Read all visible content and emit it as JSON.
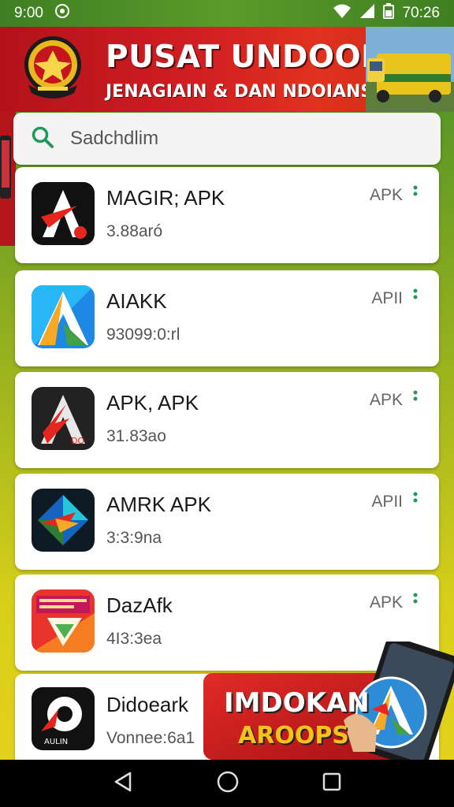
{
  "status_bar": {
    "time_left": "9:00",
    "time_right": "70:26",
    "icons": [
      "circle-status-icon",
      "wifi-icon",
      "signal-icon",
      "battery-icon"
    ]
  },
  "banner": {
    "title": "PUSAT UNDOOHAN",
    "subtitle": "JENAGIAIN & DAN NDOIANSSIA"
  },
  "search": {
    "placeholder": "Sadchdlim"
  },
  "apps": [
    {
      "name": "MAGIR; APK",
      "size": "3.88aró",
      "type": "APK",
      "icon": "magir-app-icon"
    },
    {
      "name": "AIAKK",
      "size": "93099:0:rl",
      "type": "APII",
      "icon": "aiakk-app-icon"
    },
    {
      "name": "APK, APK",
      "size": "31.83ao",
      "type": "APK",
      "icon": "apk-apk-app-icon"
    },
    {
      "name": "AMRK APK",
      "size": "3:3:9na",
      "type": "APII",
      "icon": "amrk-app-icon"
    },
    {
      "name": "DazAfk",
      "size": "4I3:3ea",
      "type": "APK",
      "icon": "dazafk-app-icon"
    },
    {
      "name": "Didoeark",
      "size": "Vonnee:6a1",
      "type": "",
      "icon": "didoeark-app-icon"
    }
  ],
  "promo": {
    "line1": "IMDOKAN",
    "line2": "AROOPS"
  },
  "colors": {
    "banner_red": "#d21f22",
    "status_green": "#3d7f22",
    "search_icon": "#1f9a5a",
    "menu_dots": "#1f9a5a"
  },
  "nav": {
    "icons": [
      "back-icon",
      "home-icon",
      "recents-icon"
    ]
  }
}
